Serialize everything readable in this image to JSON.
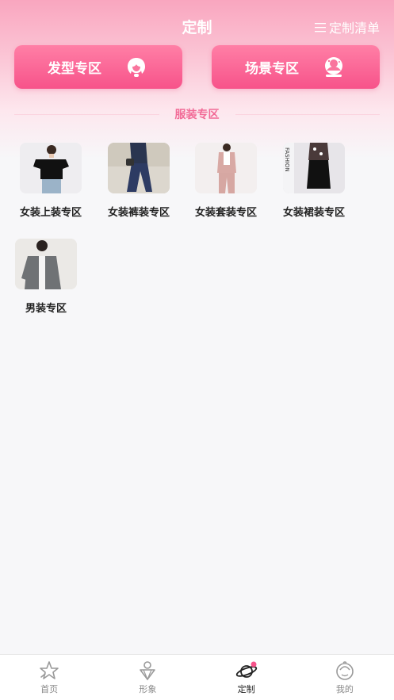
{
  "header": {
    "title": "定制",
    "right_label": "定制清单",
    "list_icon": "list-icon"
  },
  "zones": [
    {
      "label": "发型专区",
      "icon": "hairstyle-icon"
    },
    {
      "label": "场景专区",
      "icon": "scene-icon"
    }
  ],
  "section": {
    "title": "服装专区"
  },
  "categories": [
    {
      "label": "女装上装专区"
    },
    {
      "label": "女装裤装专区"
    },
    {
      "label": "女装套装专区"
    },
    {
      "label": "女装裙装专区"
    },
    {
      "label": "男装专区"
    }
  ],
  "tabbar": {
    "items": [
      {
        "label": "首页",
        "icon": "star-icon"
      },
      {
        "label": "形象",
        "icon": "diamond-icon"
      },
      {
        "label": "定制",
        "icon": "planet-icon",
        "active": true
      },
      {
        "label": "我的",
        "icon": "profile-icon"
      }
    ]
  },
  "colors": {
    "accent": "#f7538a",
    "section_text": "#f26b97"
  }
}
